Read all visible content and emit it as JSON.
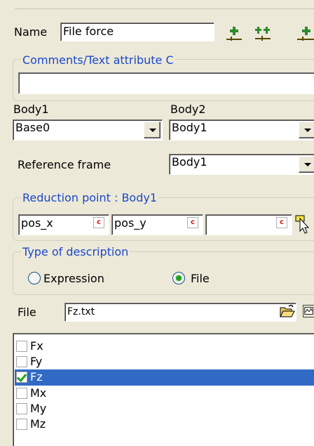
{
  "name": {
    "label": "Name",
    "value": "File force"
  },
  "comments": {
    "legend": "Comments/Text attribute C",
    "value": ""
  },
  "body1": {
    "label": "Body1",
    "value": "Base0"
  },
  "body2": {
    "label": "Body2",
    "value": "Body1"
  },
  "reference_frame": {
    "label": "Reference frame",
    "value": "Body1"
  },
  "reduction_point": {
    "legend": "Reduction point : Body1",
    "fields": [
      "pos_x",
      "pos_y",
      ""
    ],
    "c_badge": "c"
  },
  "description": {
    "legend": "Type of description",
    "options": [
      "Expression",
      "File"
    ],
    "selected": "File"
  },
  "file": {
    "label": "File",
    "value": "Fz.txt"
  },
  "components": [
    {
      "label": "Fx",
      "checked": false,
      "selected": false
    },
    {
      "label": "Fy",
      "checked": false,
      "selected": false
    },
    {
      "label": "Fz",
      "checked": true,
      "selected": true
    },
    {
      "label": "Mx",
      "checked": false,
      "selected": false
    },
    {
      "label": "My",
      "checked": false,
      "selected": false
    },
    {
      "label": "Mz",
      "checked": false,
      "selected": false
    }
  ],
  "colors": {
    "accent": "#1b48c9",
    "selection": "#316ac5",
    "check": "#21a121",
    "background": "#ece9d8"
  },
  "icons": [
    "add-green-icon",
    "add-multiple-green-icon",
    "add-edge-icon",
    "pointer-select-icon",
    "open-folder-icon",
    "plot-preview-icon"
  ]
}
